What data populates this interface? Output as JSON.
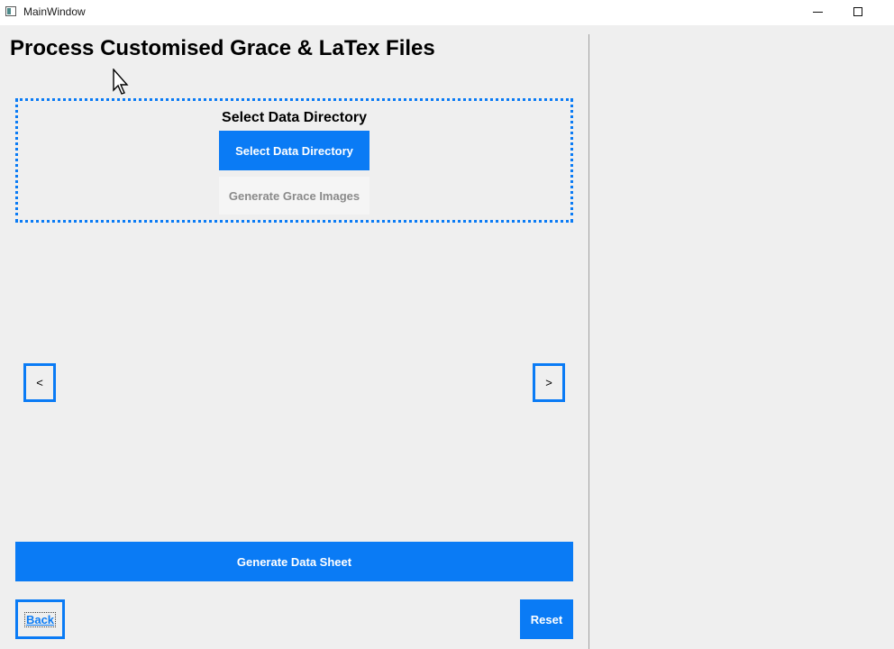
{
  "window": {
    "title": "MainWindow"
  },
  "page": {
    "title": "Process Customised Grace & LaTex Files"
  },
  "directory_panel": {
    "title": "Select Data Directory",
    "select_button": "Select Data Directory",
    "generate_grace_button": "Generate Grace Images"
  },
  "navigation": {
    "prev_label": "<",
    "next_label": ">"
  },
  "actions": {
    "generate_sheet": "Generate Data Sheet",
    "back": "Back",
    "reset": "Reset"
  },
  "colors": {
    "accent": "#0a7bf5",
    "background": "#efefef",
    "disabled_text": "#8a8a8a"
  }
}
